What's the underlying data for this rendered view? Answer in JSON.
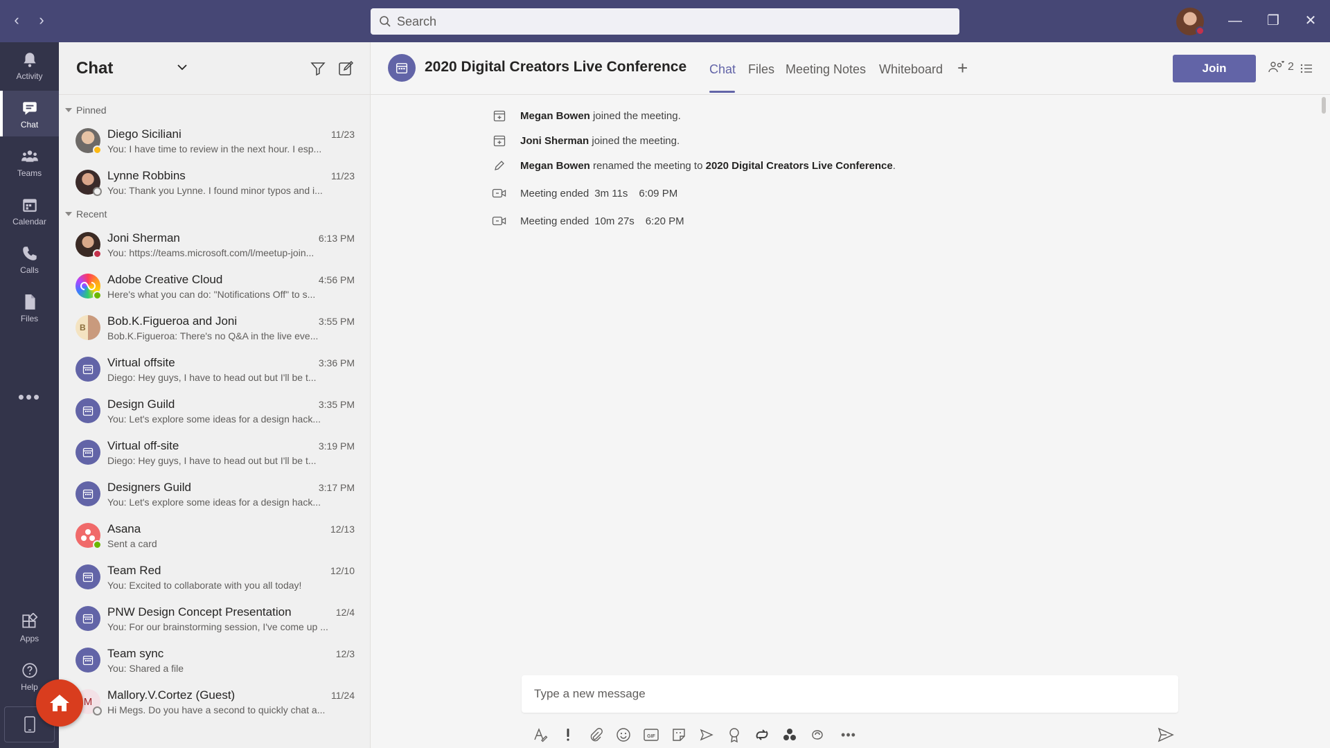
{
  "titlebar": {
    "search_placeholder": "Search",
    "back_glyph": "‹",
    "forward_glyph": "›",
    "minimize_glyph": "—",
    "maximize_glyph": "❐",
    "close_glyph": "✕",
    "accent_color": "#464775"
  },
  "rail": {
    "items": [
      {
        "label": "Activity",
        "icon": "bell-icon"
      },
      {
        "label": "Chat",
        "icon": "chat-icon",
        "active": true
      },
      {
        "label": "Teams",
        "icon": "teams-icon"
      },
      {
        "label": "Calendar",
        "icon": "calendar-icon"
      },
      {
        "label": "Calls",
        "icon": "phone-icon"
      },
      {
        "label": "Files",
        "icon": "files-icon"
      }
    ],
    "more_glyph": "•••",
    "bottom": [
      {
        "label": "Apps",
        "icon": "apps-icon"
      },
      {
        "label": "Help",
        "icon": "help-icon"
      }
    ]
  },
  "chatlist": {
    "title": "Chat",
    "pinned_label": "Pinned",
    "recent_label": "Recent",
    "pinned": [
      {
        "name": "Diego Siciliani",
        "time": "11/23",
        "preview": "You: I have time to review in the next hour. I esp...",
        "status": "away"
      },
      {
        "name": "Lynne Robbins",
        "time": "11/23",
        "preview": "You: Thank you Lynne. I found minor typos and i...",
        "status": "offline"
      }
    ],
    "recent": [
      {
        "name": "Joni Sherman",
        "time": "6:13 PM",
        "preview": "You: https://teams.microsoft.com/l/meetup-join...",
        "type": "person",
        "status": "busy"
      },
      {
        "name": "Adobe Creative Cloud",
        "time": "4:56 PM",
        "preview": "Here's what you can do: \"Notifications Off\" to s...",
        "type": "app",
        "status": "available"
      },
      {
        "name": "Bob.K.Figueroa and Joni",
        "time": "3:55 PM",
        "preview": "Bob.K.Figueroa: There's no Q&A in the live eve...",
        "type": "group"
      },
      {
        "name": "Virtual offsite",
        "time": "3:36 PM",
        "preview": "Diego: Hey guys, I have to head out but I'll be t...",
        "type": "meeting"
      },
      {
        "name": "Design Guild",
        "time": "3:35 PM",
        "preview": "You: Let's explore some ideas for a design hack...",
        "type": "meeting"
      },
      {
        "name": "Virtual off-site",
        "time": "3:19 PM",
        "preview": "Diego: Hey guys, I have to head out but I'll be t...",
        "type": "meeting"
      },
      {
        "name": "Designers Guild",
        "time": "3:17 PM",
        "preview": "You: Let's explore some ideas for a design hack...",
        "type": "meeting"
      },
      {
        "name": "Asana",
        "time": "12/13",
        "preview": "Sent a card",
        "type": "asana",
        "status": "available"
      },
      {
        "name": "Team Red",
        "time": "12/10",
        "preview": "You: Excited to collaborate with you all today!",
        "type": "meeting"
      },
      {
        "name": "PNW Design Concept Presentation",
        "time": "12/4",
        "preview": "You: For our brainstorming session, I've come up ...",
        "type": "meeting"
      },
      {
        "name": "Team sync",
        "time": "12/3",
        "preview": "You: Shared a file",
        "type": "meeting"
      },
      {
        "name": "Mallory.V.Cortez (Guest)",
        "time": "11/24",
        "preview": "Hi Megs. Do you have a second to quickly chat a...",
        "type": "guest",
        "initial": "M",
        "status": "offline"
      }
    ],
    "group_initial": "B"
  },
  "main": {
    "meeting_title": "2020 Digital Creators Live Conference",
    "tabs": [
      "Chat",
      "Files",
      "Meeting Notes",
      "Whiteboard"
    ],
    "add_tab_glyph": "+",
    "join_label": "Join",
    "participant_count": "2",
    "events": [
      {
        "icon": "calendar-join-icon",
        "actor": "Megan Bowen",
        "text": "joined the meeting."
      },
      {
        "icon": "calendar-join-icon",
        "actor": "Joni Sherman",
        "text": "joined the meeting."
      },
      {
        "icon": "pencil-icon",
        "actor": "Megan Bowen",
        "text": "renamed the meeting to",
        "target": "2020 Digital Creators Live Conference",
        "suffix": "."
      },
      {
        "icon": "video-icon",
        "label": "Meeting ended",
        "duration": "3m 11s",
        "time": "6:09 PM"
      },
      {
        "icon": "video-icon",
        "label": "Meeting ended",
        "duration": "10m 27s",
        "time": "6:20 PM"
      }
    ],
    "composer_placeholder": "Type a new message",
    "toolbar": [
      "format-icon",
      "important-icon",
      "attach-icon",
      "emoji-icon",
      "gif-icon",
      "sticker-icon",
      "meet-now-icon",
      "praise-icon",
      "loop-icon",
      "apps-icon",
      "viva-icon",
      "more-icon"
    ],
    "more_glyph": "•••"
  }
}
